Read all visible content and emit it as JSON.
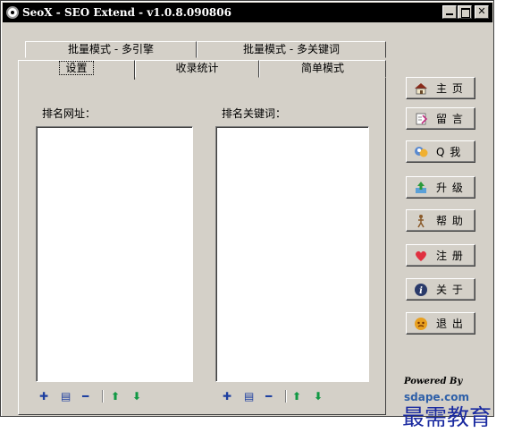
{
  "window": {
    "title": "SeoX - SEO Extend - v1.0.8.090806"
  },
  "tabs": {
    "row1": [
      "批量模式 - 多引擎",
      "批量模式 - 多关键词"
    ],
    "row2": [
      "设置",
      "收录统计",
      "简单模式"
    ],
    "active": "设置"
  },
  "panel": {
    "url_label": "排名网址：",
    "keyword_label": "排名关键词："
  },
  "controls": {
    "add": "✚",
    "edit": "▤",
    "remove": "━",
    "up": "⬆",
    "down": "⬇"
  },
  "side_buttons": [
    {
      "label": "主 页",
      "icon": "home-icon"
    },
    {
      "label": "留 言",
      "icon": "note-icon"
    },
    {
      "label": "Q 我",
      "icon": "qq-icon"
    },
    {
      "label": "升 级",
      "icon": "upgrade-icon"
    },
    {
      "label": "帮 助",
      "icon": "help-icon"
    },
    {
      "label": "注 册",
      "icon": "heart-icon"
    },
    {
      "label": "关 于",
      "icon": "info-icon"
    },
    {
      "label": "退 出",
      "icon": "exit-icon"
    }
  ],
  "footer": {
    "powered_by": "Powered By",
    "brand": "sdape.com",
    "watermark": "最需教育"
  },
  "colors": {
    "face": "#d4d0c8",
    "titlebar": "#000000",
    "control_blue": "#1c3ea0",
    "control_green": "#119944",
    "watermark": "#1a2aa0"
  }
}
